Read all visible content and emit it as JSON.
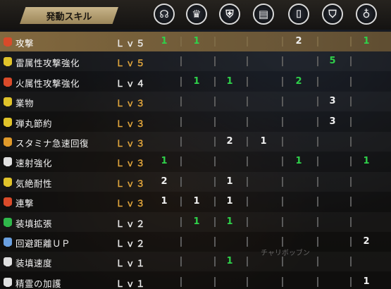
{
  "header": {
    "title": "発動スキル"
  },
  "columns": [
    {
      "icon": "amulet-icon",
      "glyph": "☊"
    },
    {
      "icon": "head-armor-icon",
      "glyph": "♛"
    },
    {
      "icon": "chest-armor-icon",
      "glyph": "⛨"
    },
    {
      "icon": "arm-armor-icon",
      "glyph": "▤"
    },
    {
      "icon": "waist-armor-icon",
      "glyph": "⌷"
    },
    {
      "icon": "leg-armor-icon",
      "glyph": "⛉"
    },
    {
      "icon": "charm-icon",
      "glyph": "♁"
    }
  ],
  "colors": {
    "green": "#2fd14a",
    "white": "#f0f0f0",
    "level_max": "#e2a63c",
    "highlight": "#96784a"
  },
  "skills": [
    {
      "name": "攻撃",
      "level": "Ｌｖ５",
      "max": false,
      "icon_color": "#d94a2a",
      "values": [
        "1",
        "1",
        "",
        "",
        "2",
        "",
        "1"
      ],
      "colors": [
        "green",
        "green",
        "",
        "",
        "white",
        "",
        "green"
      ]
    },
    {
      "name": "雷属性攻撃強化",
      "level": "Ｌｖ５",
      "max": true,
      "icon_color": "#e0c32a",
      "values": [
        "",
        "",
        "",
        "",
        "",
        "5",
        ""
      ],
      "colors": [
        "",
        "",
        "",
        "",
        "",
        "green",
        ""
      ]
    },
    {
      "name": "火属性攻撃強化",
      "level": "Ｌｖ４",
      "max": false,
      "icon_color": "#d94a2a",
      "values": [
        "",
        "1",
        "1",
        "",
        "2",
        "",
        ""
      ],
      "colors": [
        "",
        "green",
        "green",
        "",
        "green",
        "",
        ""
      ]
    },
    {
      "name": "業物",
      "level": "Ｌｖ３",
      "max": true,
      "icon_color": "#e0c32a",
      "values": [
        "",
        "",
        "",
        "",
        "",
        "3",
        ""
      ],
      "colors": [
        "",
        "",
        "",
        "",
        "",
        "white",
        ""
      ]
    },
    {
      "name": "弾丸節約",
      "level": "Ｌｖ３",
      "max": true,
      "icon_color": "#e0c32a",
      "values": [
        "",
        "",
        "",
        "",
        "",
        "3",
        ""
      ],
      "colors": [
        "",
        "",
        "",
        "",
        "",
        "white",
        ""
      ]
    },
    {
      "name": "スタミナ急速回復",
      "level": "Ｌｖ３",
      "max": true,
      "icon_color": "#e09a2a",
      "values": [
        "",
        "",
        "2",
        "1",
        "",
        "",
        ""
      ],
      "colors": [
        "",
        "",
        "white",
        "white",
        "",
        "",
        ""
      ]
    },
    {
      "name": "速射強化",
      "level": "Ｌｖ３",
      "max": true,
      "icon_color": "#e0e0e0",
      "values": [
        "1",
        "",
        "",
        "",
        "1",
        "",
        "1"
      ],
      "colors": [
        "green",
        "",
        "",
        "",
        "green",
        "",
        "green"
      ]
    },
    {
      "name": "気絶耐性",
      "level": "Ｌｖ３",
      "max": true,
      "icon_color": "#e0c32a",
      "values": [
        "2",
        "",
        "1",
        "",
        "",
        "",
        ""
      ],
      "colors": [
        "white",
        "",
        "white",
        "",
        "",
        "",
        ""
      ],
      "offset": [
        1,
        0,
        2,
        0,
        0,
        0,
        0
      ]
    },
    {
      "name": "連撃",
      "level": "Ｌｖ３",
      "max": true,
      "icon_color": "#d94a2a",
      "values": [
        "1",
        "1",
        "1",
        "",
        "",
        "",
        ""
      ],
      "colors": [
        "white",
        "white",
        "white",
        "",
        "",
        "",
        ""
      ],
      "offset": [
        1,
        1,
        1,
        0,
        0,
        0,
        0
      ]
    },
    {
      "name": "装填拡張",
      "level": "Ｌｖ２",
      "max": false,
      "icon_color": "#2fb84a",
      "values": [
        "",
        "1",
        "1",
        "",
        "",
        "",
        ""
      ],
      "colors": [
        "",
        "green",
        "green",
        "",
        "",
        "",
        ""
      ]
    },
    {
      "name": "回避距離ＵＰ",
      "level": "Ｌｖ２",
      "max": false,
      "icon_color": "#6aa0e0",
      "values": [
        "",
        "",
        "",
        "",
        "",
        "",
        "2"
      ],
      "colors": [
        "",
        "",
        "",
        "",
        "",
        "",
        "white"
      ]
    },
    {
      "name": "装填速度",
      "level": "Ｌｖ１",
      "max": false,
      "icon_color": "#e0e0e0",
      "values": [
        "",
        "",
        "1",
        "",
        "",
        "",
        ""
      ],
      "colors": [
        "",
        "",
        "green",
        "",
        "",
        "",
        ""
      ]
    },
    {
      "name": "精霊の加護",
      "level": "Ｌｖ１",
      "max": false,
      "icon_color": "#e0e0e0",
      "values": [
        "",
        "",
        "",
        "",
        "",
        "",
        "1"
      ],
      "colors": [
        "",
        "",
        "",
        "",
        "",
        "",
        "white"
      ]
    }
  ],
  "watermark": "チャリボッブン"
}
